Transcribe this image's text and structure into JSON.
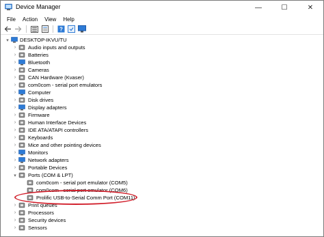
{
  "window": {
    "title": "Device Manager",
    "controls": {
      "minimize": "—",
      "maximize": "☐",
      "close": "✕"
    }
  },
  "menu": [
    "File",
    "Action",
    "View",
    "Help"
  ],
  "toolbar": {
    "buttons": [
      "back-icon",
      "forward-icon",
      "device-view-icon",
      "properties-icon",
      "help-icon",
      "update-driver-icon",
      "monitor-icon"
    ]
  },
  "tree": {
    "root": "DESKTOP-IKVU/TU",
    "categories": [
      "Audio inputs and outputs",
      "Batteries",
      "Bluetooth",
      "Cameras",
      "CAN Hardware (Kvaser)",
      "com0com - serial port emulators",
      "Computer",
      "Disk drives",
      "Display adapters",
      "Firmware",
      "Human Interface Devices",
      "IDE ATA/ATAPI controllers",
      "Keyboards",
      "Mice and other pointing devices",
      "Monitors",
      "Network adapters",
      "Portable Devices"
    ],
    "ports": {
      "label": "Ports (COM & LPT)",
      "children": [
        "com0com - serial port emulator (COM5)",
        "com0com - serial port emulator (COM6)",
        "Prolific USB-to-Serial Comm Port (COM11)"
      ]
    },
    "after": [
      "Print queues",
      "Processors",
      "Security devices",
      "Sensors"
    ]
  },
  "colors": {
    "highlight": "#d11f2b",
    "chevron": "#6b6b6b",
    "icon_blue": "#2e7bd6"
  }
}
